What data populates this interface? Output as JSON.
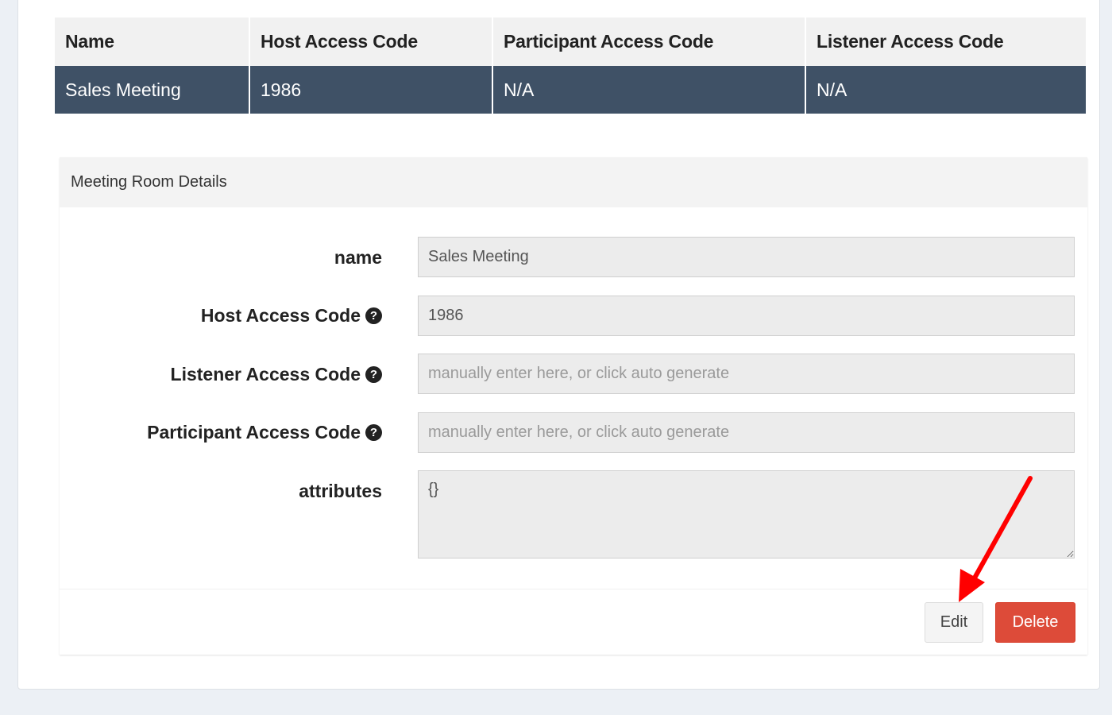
{
  "table": {
    "headers": {
      "name": "Name",
      "host": "Host Access Code",
      "participant": "Participant Access Code",
      "listener": "Listener Access Code"
    },
    "rows": [
      {
        "name": "Sales Meeting",
        "host": "1986",
        "participant": "N/A",
        "listener": "N/A"
      }
    ]
  },
  "details": {
    "heading": "Meeting Room Details",
    "fields": {
      "name": {
        "label": "name",
        "value": "Sales Meeting"
      },
      "host": {
        "label": "Host Access Code",
        "value": "1986"
      },
      "listener": {
        "label": "Listener Access Code",
        "value": "",
        "placeholder": "manually enter here, or click auto generate"
      },
      "participant": {
        "label": "Participant Access Code",
        "value": "",
        "placeholder": "manually enter here, or click auto generate"
      },
      "attributes": {
        "label": "attributes",
        "value": "{}"
      }
    },
    "help_icon_glyph": "?",
    "buttons": {
      "edit": "Edit",
      "delete": "Delete"
    }
  },
  "colors": {
    "selected_row": "#3f5166",
    "delete_button": "#dd4b39",
    "annotation_arrow": "#ff0000"
  },
  "icons": {
    "help": "question-circle-icon"
  }
}
